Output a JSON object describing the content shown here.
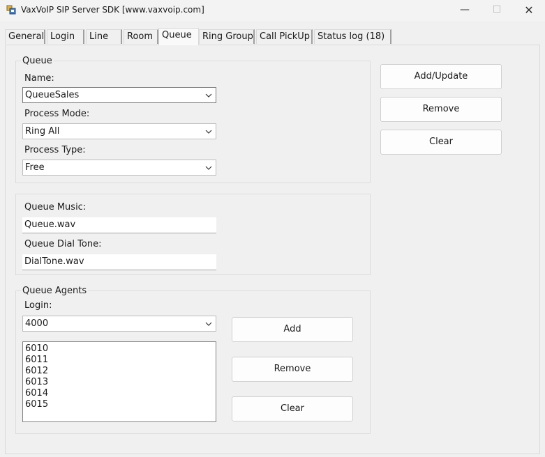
{
  "window": {
    "title": "VaxVoIP SIP Server SDK [www.vaxvoip.com]",
    "minimize": "—",
    "maximize": "☐",
    "close": "✕"
  },
  "tabs": [
    {
      "label": "General"
    },
    {
      "label": "Login"
    },
    {
      "label": "Line"
    },
    {
      "label": "Room"
    },
    {
      "label": "Queue"
    },
    {
      "label": "Ring Group"
    },
    {
      "label": "Call PickUp"
    },
    {
      "label": "Status log (18)"
    }
  ],
  "active_tab": "Queue",
  "queue": {
    "group_title": "Queue",
    "name_label": "Name:",
    "name_value": "QueueSales",
    "process_mode_label": "Process Mode:",
    "process_mode_value": "Ring All",
    "process_type_label": "Process Type:",
    "process_type_value": "Free"
  },
  "music": {
    "music_label": "Queue Music:",
    "music_value": "Queue.wav",
    "dial_tone_label": "Queue Dial Tone:",
    "dial_tone_value": "DialTone.wav"
  },
  "agents": {
    "group_title": "Queue Agents",
    "login_label": "Login:",
    "login_value": "4000",
    "list": [
      "6010",
      "6011",
      "6012",
      "6013",
      "6014",
      "6015"
    ],
    "add_label": "Add",
    "remove_label": "Remove",
    "clear_label": "Clear"
  },
  "actions": {
    "add_update_label": "Add/Update",
    "remove_label": "Remove",
    "clear_label": "Clear"
  },
  "icons": {
    "app": "app-icon",
    "dropdown": "chevron-down-icon"
  },
  "colors": {
    "background": "#f0f0f0",
    "border": "#7a7a7a"
  }
}
